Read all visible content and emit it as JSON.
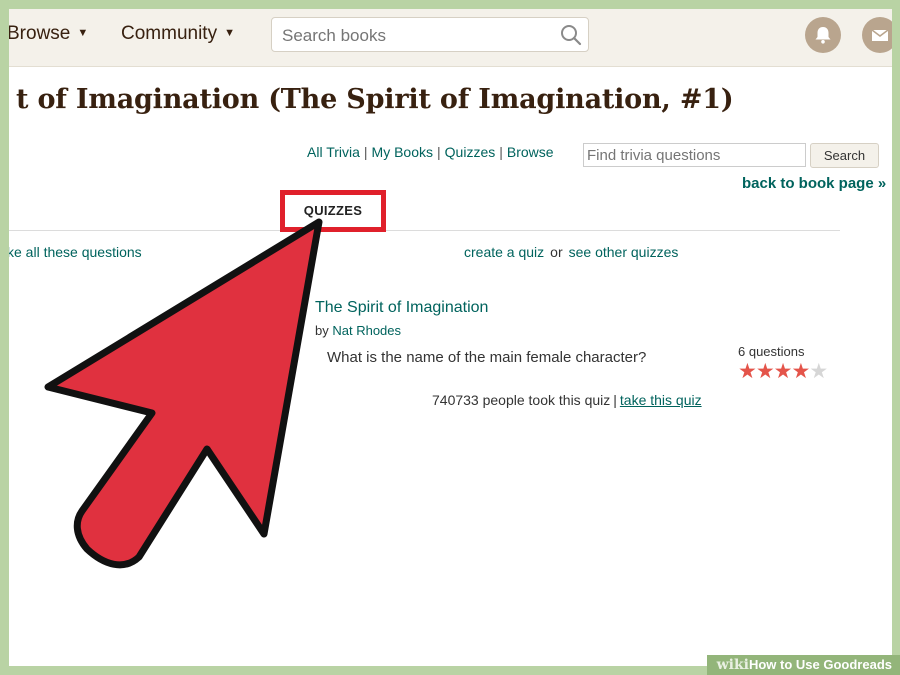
{
  "nav": {
    "browse_label": "Browse",
    "community_label": "Community",
    "search_placeholder": "Search books",
    "icons": [
      "search-icon",
      "bell-icon",
      "mail-icon"
    ]
  },
  "book": {
    "title": "t of Imagination (The Spirit of Imagination, #1)"
  },
  "trivia_links": [
    "All Trivia",
    "My Books",
    "Quizzes",
    "Browse"
  ],
  "trivia_search": {
    "placeholder": "Find trivia questions",
    "button_label": "Search"
  },
  "back_link": "back to book page »",
  "tab": {
    "label": "QUIZZES"
  },
  "actions": {
    "take_all": "ke all these questions",
    "create_quiz": "create a quiz",
    "or": "or",
    "see_other": "see other quizzes"
  },
  "quiz": {
    "title": "The Spirit of Imagination",
    "by": "by",
    "author": "Nat Rhodes",
    "question": "What is the name of the main female character?",
    "question_count": "6 questions",
    "rating": 4,
    "rating_max": 5,
    "takers": "740733 people took this quiz",
    "take_link": "take this quiz"
  },
  "watermark": {
    "wiki": "wiki",
    "how": "How",
    "rest": " to Use Goodreads"
  },
  "colors": {
    "link": "#00635d",
    "highlight_red": "#e0202b",
    "arrow_fill": "#e0313f",
    "star_on": "#e4544a",
    "frame_bg": "#b9d3a4"
  }
}
